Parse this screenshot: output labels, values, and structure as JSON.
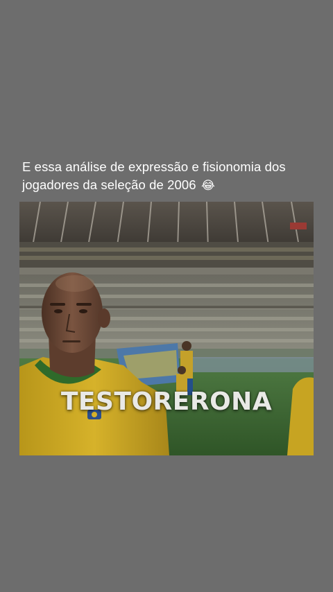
{
  "post": {
    "caption_line1": "E essa análise de expressão e fisionomia dos",
    "caption_line2": "jogadores da seleção de 2006",
    "caption_emoji": "😂"
  },
  "video": {
    "overlay_text": "TESTORERONA"
  },
  "colors": {
    "background": "#6d6d6d",
    "caption_text": "#ffffff",
    "jersey_yellow": "#c9a51a",
    "jersey_green": "#2f6a2a",
    "pitch_green": "#3e6a33"
  }
}
